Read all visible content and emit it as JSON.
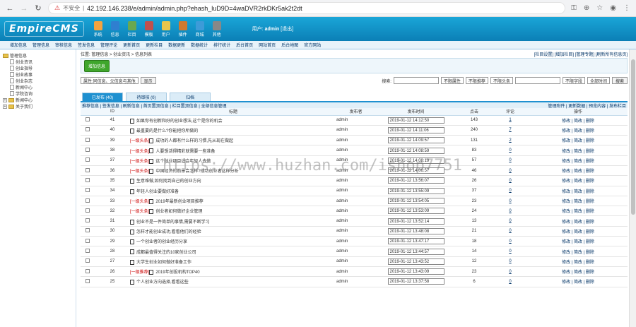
{
  "browser": {
    "insecure": "不安全",
    "url": "42.192.146.238/e/admin/admin.php?ehash_luD9D=4waDVR2rkDKr5ak2t2dt"
  },
  "header": {
    "logo": "EmpireCMS",
    "menu": [
      "系统",
      "信息",
      "栏目",
      "模板",
      "用户",
      "插件",
      "商城",
      "其他"
    ],
    "user_label": "用户:",
    "user": "admin",
    "logout": "[退出]"
  },
  "submenu": [
    "增加信息",
    "管理信息",
    "审核信息",
    "签发信息",
    "管理评论",
    "更新首页",
    "更新栏目",
    "数据更新",
    "数据统计",
    "排行统计",
    "后台首页",
    "网站首页",
    "后台地图",
    "官方网站"
  ],
  "sidebar": {
    "root": "管理信息",
    "items": [
      "创业资讯",
      "创业指导",
      "创业故事",
      "创业杂志",
      "新闻中心",
      "学院咨询",
      "新闻中心",
      "关于我们"
    ]
  },
  "breadcrumb": {
    "left": "位置: 管理信息 > 创业资讯 > 信息列表",
    "right": "[栏目设置] [增加栏目] [管理专题] [刷新所有信息页]"
  },
  "toolbar": {
    "add": "增加信息",
    "filter": "属性:同信息、父信息与其他",
    "show": "显示",
    "search_label": "搜索:",
    "s1": "不限属性",
    "s2": "不限推荐",
    "s3": "不限头条",
    "s4": "不限字段",
    "s5": "全部时间",
    "search": "搜索"
  },
  "tabs": [
    "已发布 (40)",
    "待审核 (0)",
    "归档"
  ],
  "listbar": {
    "left": "推荐信息 | 签发信息 | 刷新信息 | 首页置顶信息 | 栏目置顶信息 | 全部信息管理",
    "right": "管理附件 | 更新数据 | 预览内容 | 发布栏目"
  },
  "columns": [
    "ID",
    "标题",
    "发布者",
    "发布时间",
    "点击",
    "评论",
    "操作"
  ],
  "rows": [
    {
      "id": "41",
      "tag": "",
      "title": "如果你有创新和好的创业想法,这个是你的机会",
      "author": "admin",
      "time": "2019-01-12 14:12:50",
      "clicks": "143",
      "comments": "1"
    },
    {
      "id": "40",
      "tag": "",
      "title": "最重要的是什么?你能把你所做的",
      "author": "admin",
      "time": "2019-01-12 14:11:06",
      "clicks": "240",
      "comments": "7"
    },
    {
      "id": "39",
      "tag": "[一级头条]",
      "title": "成功的人都有什么样的习惯,先从现在做起",
      "author": "admin",
      "time": "2019-01-12 14:09:57",
      "clicks": "131",
      "comments": "2"
    },
    {
      "id": "38",
      "tag": "[一级头条]",
      "title": "人要想活得精彩就需要一些准备",
      "author": "admin",
      "time": "2019-01-12 14:08:59",
      "clicks": "83",
      "comments": "0"
    },
    {
      "id": "37",
      "tag": "[一级头条]",
      "title": "这个创业项目适合年轻人去做",
      "author": "admin",
      "time": "2019-01-12 14:08:19",
      "clicks": "57",
      "comments": "0"
    },
    {
      "id": "36",
      "tag": "[一级头条]",
      "title": "中国经济的前景会怎样?成功创业者这样分析",
      "author": "admin",
      "time": "2019-01-12 14:06:57",
      "clicks": "46",
      "comments": "0"
    },
    {
      "id": "35",
      "tag": "",
      "title": "生意难做,如何找到自己的创业方向",
      "author": "admin",
      "time": "2019-01-12 13:56:07",
      "clicks": "26",
      "comments": "0"
    },
    {
      "id": "34",
      "tag": "",
      "title": "年轻人创业要做好准备",
      "author": "admin",
      "time": "2019-01-12 13:55:09",
      "clicks": "37",
      "comments": "0"
    },
    {
      "id": "33",
      "tag": "[一级头条]",
      "title": "2019年最新创业项目推荐",
      "author": "admin",
      "time": "2019-01-12 13:54:05",
      "clicks": "23",
      "comments": "0"
    },
    {
      "id": "32",
      "tag": "[一级头条]",
      "title": "创业者如何做好企业管理",
      "author": "admin",
      "time": "2019-01-12 13:53:09",
      "clicks": "24",
      "comments": "0"
    },
    {
      "id": "31",
      "tag": "",
      "title": "创业不是一件简单的事情,需要不断学习",
      "author": "admin",
      "time": "2019-01-12 13:52:14",
      "clicks": "13",
      "comments": "0"
    },
    {
      "id": "30",
      "tag": "",
      "title": "怎样才能创业成功,看看他们的经验",
      "author": "admin",
      "time": "2019-01-12 13:48:08",
      "clicks": "21",
      "comments": "0"
    },
    {
      "id": "29",
      "tag": "",
      "title": "一个创业者的创业经历分享",
      "author": "admin",
      "time": "2019-01-12 13:47:17",
      "clicks": "18",
      "comments": "0"
    },
    {
      "id": "28",
      "tag": "",
      "title": "成都最值得关注的10家创业公司",
      "author": "admin",
      "time": "2019-01-12 13:44:57",
      "clicks": "14",
      "comments": "0"
    },
    {
      "id": "27",
      "tag": "",
      "title": "大学生创业如何做好准备工作",
      "author": "admin",
      "time": "2019-01-12 13:43:52",
      "clicks": "12",
      "comments": "0"
    },
    {
      "id": "26",
      "tag": "[一级推荐]",
      "title": "2019年创投机构TOP40",
      "author": "admin",
      "time": "2019-01-12 13:43:09",
      "clicks": "23",
      "comments": "0"
    },
    {
      "id": "25",
      "tag": "",
      "title": "个人创业方向选择,看看这些",
      "author": "admin",
      "time": "2019-01-12 13:37:58",
      "clicks": "6",
      "comments": "0"
    }
  ],
  "ops": "修改 | 简改 | 删除",
  "watermark": "https://www.huzhan.com/ishop7751"
}
